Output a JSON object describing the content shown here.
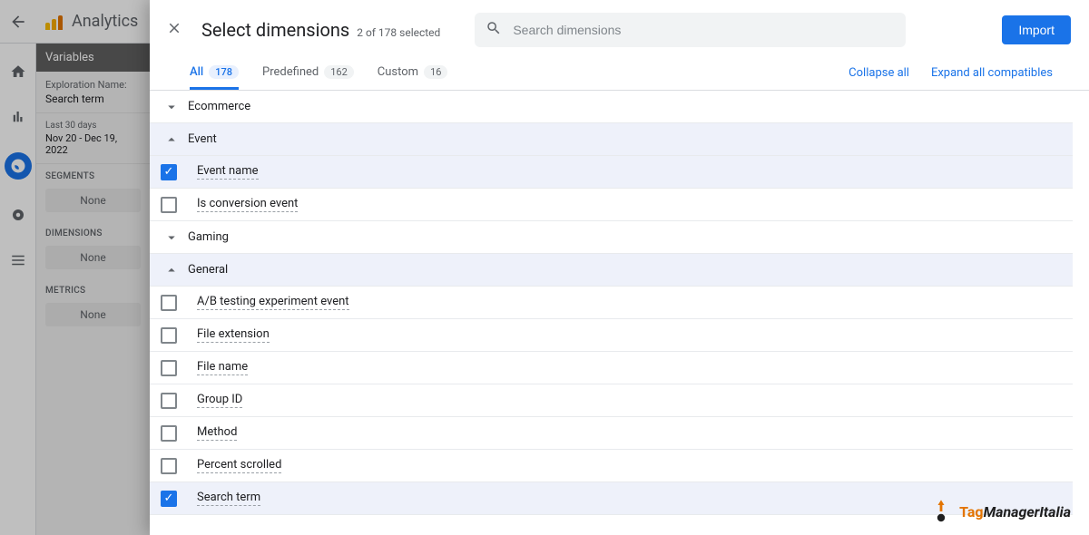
{
  "topbar": {
    "product_name": "Analytics"
  },
  "sidebar": {
    "header": "Variables",
    "exploration_label": "Exploration Name:",
    "exploration_value": "Search term",
    "date_range_label": "Last 30 days",
    "date_range_value": "Nov 20 - Dec 19, 2022",
    "sections": [
      {
        "title": "SEGMENTS",
        "none": "None"
      },
      {
        "title": "DIMENSIONS",
        "none": "None"
      },
      {
        "title": "METRICS",
        "none": "None"
      }
    ]
  },
  "modal": {
    "title": "Select dimensions",
    "subtitle": "2 of 178 selected",
    "search_placeholder": "Search dimensions",
    "import_label": "Import",
    "tabs": [
      {
        "label": "All",
        "count": "178",
        "active": true
      },
      {
        "label": "Predefined",
        "count": "162",
        "active": false
      },
      {
        "label": "Custom",
        "count": "16",
        "active": false
      }
    ],
    "links": {
      "collapse": "Collapse all",
      "expand": "Expand all compatibles"
    },
    "groups": [
      {
        "label": "Ecommerce",
        "expanded": false,
        "items": []
      },
      {
        "label": "Event",
        "expanded": true,
        "items": [
          {
            "label": "Event name",
            "checked": true
          },
          {
            "label": "Is conversion event",
            "checked": false
          }
        ]
      },
      {
        "label": "Gaming",
        "expanded": false,
        "items": []
      },
      {
        "label": "General",
        "expanded": true,
        "items": [
          {
            "label": "A/B testing experiment event",
            "checked": false
          },
          {
            "label": "File extension",
            "checked": false
          },
          {
            "label": "File name",
            "checked": false
          },
          {
            "label": "Group ID",
            "checked": false
          },
          {
            "label": "Method",
            "checked": false
          },
          {
            "label": "Percent scrolled",
            "checked": false
          },
          {
            "label": "Search term",
            "checked": true
          }
        ]
      }
    ]
  },
  "watermark": {
    "prefix": "Tag",
    "suffix": "ManagerItalia"
  }
}
